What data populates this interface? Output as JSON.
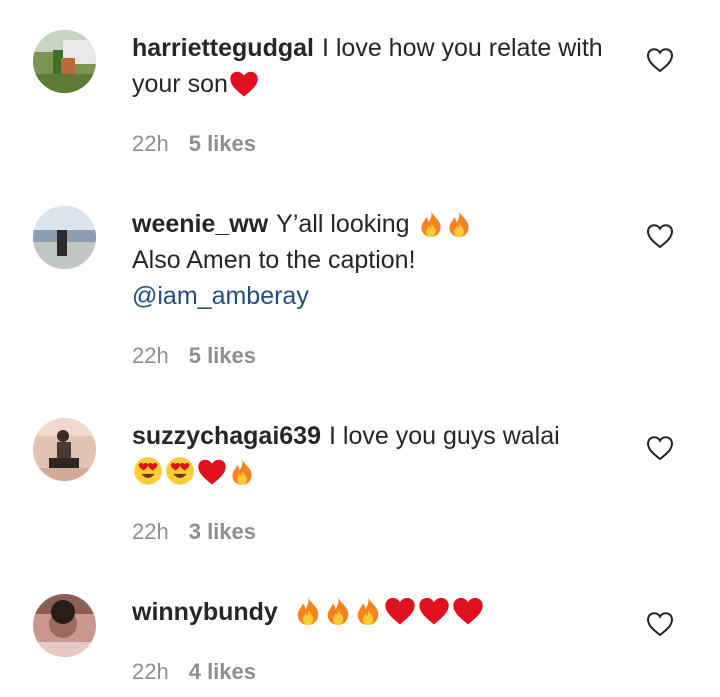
{
  "comments": [
    {
      "username": "harriettegudgal",
      "text": "I love how you relate with your son",
      "time": "22h",
      "likes": "5 likes"
    },
    {
      "username": "weenie_ww",
      "text_line1": "Y’all looking",
      "text_line2": "Also Amen to the caption!",
      "mention": "@iam_amberay",
      "time": "22h",
      "likes": "5 likes"
    },
    {
      "username": "suzzychagai639",
      "text": "I love you guys walai",
      "time": "22h",
      "likes": "3 likes"
    },
    {
      "username": "winnybundy",
      "time": "22h",
      "likes": "4 likes"
    }
  ],
  "colors": {
    "text": "#262626",
    "meta": "#8e8e8e",
    "mention": "#1f4f7a",
    "heart_emoji": "#e0101e",
    "fire_emoji": "#f5821f"
  },
  "icons": {
    "like_button": "heart-outline-icon",
    "emoji_heart": "red-heart-emoji",
    "emoji_fire": "fire-emoji",
    "emoji_heart_eyes": "heart-eyes-emoji"
  }
}
